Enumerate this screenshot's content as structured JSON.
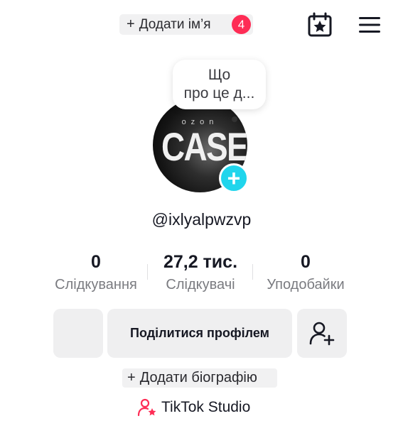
{
  "header": {
    "add_name_plus": "+",
    "add_name_label": "Додати ім’я",
    "notification_count": "4",
    "calendar_icon": "calendar-star-icon",
    "menu_icon": "hamburger-menu-icon"
  },
  "bubble": {
    "line1": "Що",
    "line2": "про це д..."
  },
  "avatar": {
    "brand_small": "ozon",
    "brand_big": "CASE",
    "add_plus": "+"
  },
  "profile": {
    "username": "@ixlyalpwzvp"
  },
  "stats": [
    {
      "value": "0",
      "label": "Слідкування"
    },
    {
      "value": "27,2 тис.",
      "label": "Слідкувачі"
    },
    {
      "value": "0",
      "label": "Уподобайки"
    }
  ],
  "actions": {
    "share_label": "Поділитися профілем",
    "add_friend_icon": "add-friend-icon"
  },
  "bio": {
    "plus": "+",
    "label": "Додати біографію"
  },
  "studio": {
    "label": "TikTok Studio",
    "icon": "person-star-icon"
  },
  "colors": {
    "accent_red": "#fe2c55",
    "accent_cyan": "#20d5ec",
    "button_bg": "#efeff0"
  }
}
